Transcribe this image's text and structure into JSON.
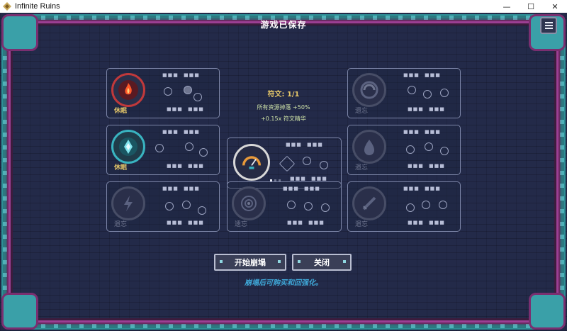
{
  "window": {
    "title": "Infinite Ruins",
    "controls": [
      "—",
      "☐",
      "✕"
    ]
  },
  "game": {
    "saved_notice": "游戏已保存",
    "rune": {
      "title": "符文: 1/1",
      "line1": "所有资源掉落 +50%",
      "line2": "+0.15x 符文精华"
    },
    "cards": [
      {
        "id": "fire",
        "label": "休眠",
        "state": "active",
        "color": "#c0393b",
        "icon": "fire-emblem-icon"
      },
      {
        "id": "void-top",
        "label": "遗忘",
        "state": "forgotten",
        "color": "#6f7690",
        "icon": "vortex-emblem-icon"
      },
      {
        "id": "frost",
        "label": "休眠",
        "state": "active",
        "color": "#39b3c0",
        "icon": "crystal-emblem-icon"
      },
      {
        "id": "center",
        "label": "",
        "state": "current",
        "color": "#d8d8d8",
        "icon": "gauge-emblem-icon"
      },
      {
        "id": "droplet",
        "label": "遗忘",
        "state": "forgotten",
        "color": "#6f7690",
        "icon": "droplet-emblem-icon"
      },
      {
        "id": "lightning",
        "label": "遗忘",
        "state": "forgotten",
        "color": "#6f7690",
        "icon": "lightning-emblem-icon"
      },
      {
        "id": "target",
        "label": "遗忘",
        "state": "forgotten",
        "color": "#6f7690",
        "icon": "target-emblem-icon"
      },
      {
        "id": "blade",
        "label": "遗忘",
        "state": "forgotten",
        "color": "#6f7690",
        "icon": "blade-emblem-icon"
      }
    ],
    "buttons": {
      "start": "开始崩塌",
      "close": "关闭"
    },
    "hint": "崩塌后可购买和回强化。"
  }
}
